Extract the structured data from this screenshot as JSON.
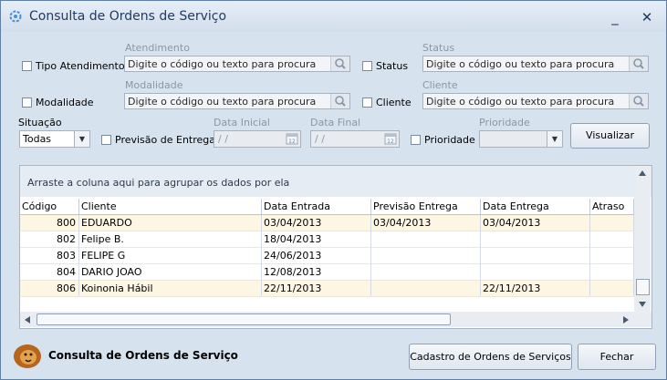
{
  "window": {
    "title": "Consulta de Ordens de Serviço",
    "minimize_glyph": "_",
    "close_glyph": "✕"
  },
  "filters": {
    "tipo_atendimento": {
      "label": "Tipo Atendimento",
      "checked": false
    },
    "atendimento": {
      "label": "Atendimento",
      "placeholder": "Digite o código ou texto para procura"
    },
    "status_check": {
      "label": "Status",
      "checked": false
    },
    "status": {
      "label": "Status",
      "placeholder": "Digite o código ou texto para procura"
    },
    "modalidade_check": {
      "label": "Modalidade",
      "checked": false
    },
    "modalidade": {
      "label": "Modalidade",
      "placeholder": "Digite o código ou texto para procura"
    },
    "cliente_check": {
      "label": "Cliente",
      "checked": false
    },
    "cliente": {
      "label": "Cliente",
      "placeholder": "Digite o código ou texto para procura"
    },
    "situacao": {
      "label": "Situação",
      "value": "Todas"
    },
    "previsao_entrega": {
      "label": "Previsão de Entrega",
      "checked": false
    },
    "data_inicial": {
      "label": "Data Inicial",
      "value": " / /"
    },
    "data_final": {
      "label": "Data Final",
      "value": " / /"
    },
    "prioridade_check": {
      "label": "Prioridade",
      "checked": false
    },
    "prioridade": {
      "label": "Prioridade",
      "value": ""
    },
    "visualizar_button": "Visualizar"
  },
  "grid": {
    "group_hint": "Arraste a coluna aqui para agrupar os dados por ela",
    "columns": [
      "Código",
      "Cliente",
      "Data Entrada",
      "Previsão Entrega",
      "Data Entrega",
      "Atraso"
    ],
    "rows": [
      [
        "800",
        "EDUARDO",
        "03/04/2013",
        "03/04/2013",
        "03/04/2013",
        ""
      ],
      [
        "802",
        "Felipe B.",
        "18/04/2013",
        "",
        "",
        ""
      ],
      [
        "803",
        "FELIPE G",
        "24/06/2013",
        "",
        "",
        ""
      ],
      [
        "804",
        "DARIO JOAO",
        "12/08/2013",
        "",
        "",
        ""
      ],
      [
        "806",
        "Koinonia Hábil",
        "22/11/2013",
        "",
        "22/11/2013",
        ""
      ]
    ],
    "selected_row": 0,
    "highlighted_row": 4
  },
  "footer": {
    "title": "Consulta de Ordens de Serviço",
    "cadastro_button": "Cadastro de Ordens de Serviços",
    "fechar_button": "Fechar"
  },
  "colors": {
    "window_bg": "#d7e2ef",
    "title_text": "#1e3a5c",
    "selected_row_bg": "#fdf6e3",
    "grid_border": "#a8b6c7"
  },
  "icons": {
    "app": "gear-swirl-icon",
    "search": "magnifier-icon",
    "calendar": "calendar-icon",
    "logo": "lion-logo-icon"
  }
}
